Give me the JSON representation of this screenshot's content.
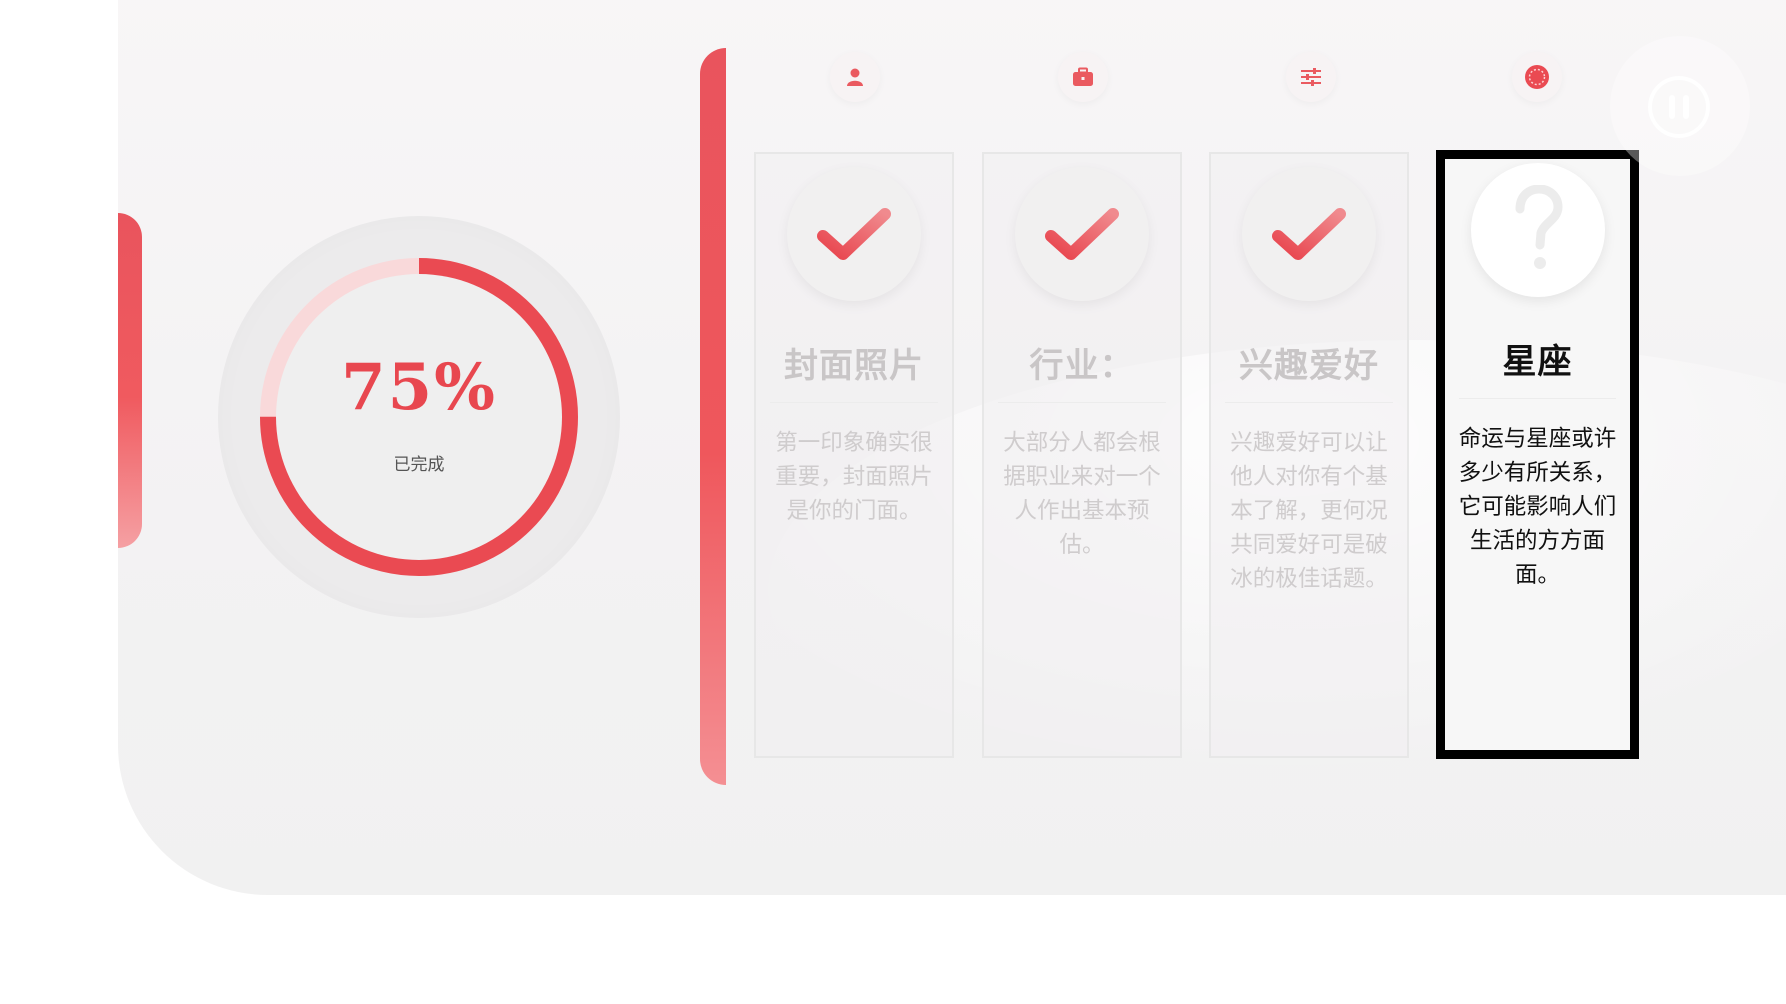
{
  "progress": {
    "percent_text": "75%",
    "percent_value": 0.75,
    "label": "已完成",
    "accent_color": "#ea4a52",
    "track_color": "#f9d9da"
  },
  "steps": [
    {
      "icon": "user-icon"
    },
    {
      "icon": "briefcase-icon"
    },
    {
      "icon": "sliders-icon"
    },
    {
      "icon": "zodiac-icon"
    }
  ],
  "cards": [
    {
      "title": "封面照片",
      "desc": "第一印象确实很重要，封面照片是你的门面。",
      "status": "done"
    },
    {
      "title": "行业：",
      "desc": "大部分人都会根据职业来对一个人作出基本预估。",
      "status": "done"
    },
    {
      "title": "兴趣爱好",
      "desc": "兴趣爱好可以让他人对你有个基本了解，更何况共同爱好可是破冰的极佳话题。",
      "status": "done"
    },
    {
      "title": "星座",
      "desc": "命运与星座或许多少有所关系，它可能影响人们生活的方方面面。",
      "status": "current"
    }
  ],
  "controls": {
    "pause": "pause-icon"
  }
}
